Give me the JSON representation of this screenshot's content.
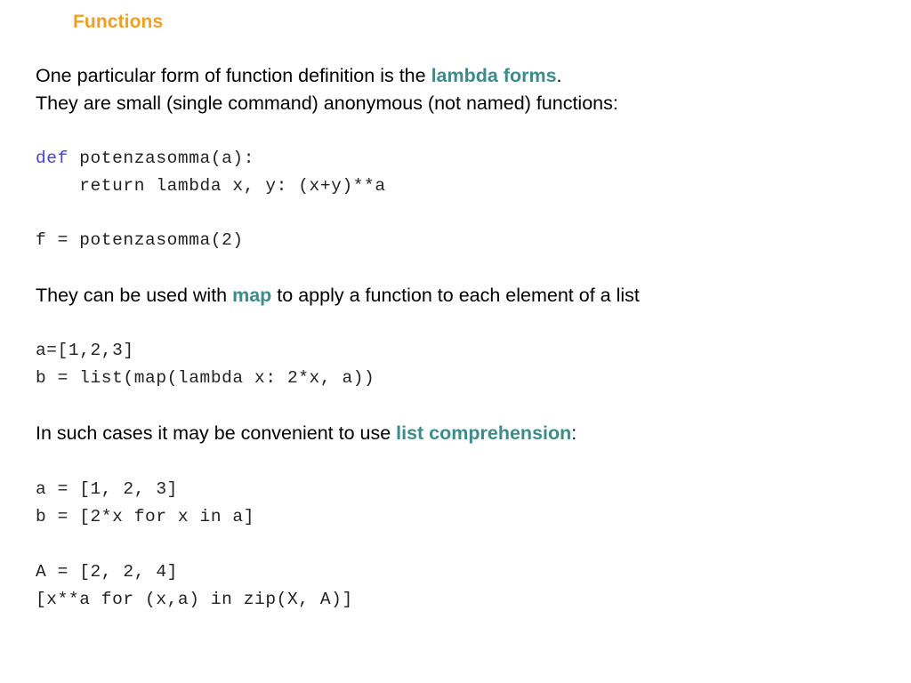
{
  "slide": {
    "title": "Functions",
    "colors": {
      "title": "#f0a01e",
      "keyword_teal": "#3d8b8b",
      "code_keyword_blue": "#4a43cc",
      "body_text": "#000000",
      "code_text": "#222222",
      "background": "#ffffff"
    }
  },
  "intro": {
    "line1_before": "One particular form of function definition is the ",
    "line1_highlight": "lambda forms",
    "line1_after": ".",
    "line2": "They are small (single command) anonymous (not named) functions:"
  },
  "code_block_1": {
    "line1_keyword": "def",
    "line1_rest": " potenzasomma(a):",
    "line2": "    return lambda x, y: (x+y)**a"
  },
  "code_block_2": {
    "line1": "f = potenzasomma(2)"
  },
  "map_para": {
    "before": "They can be used with ",
    "highlight": "map",
    "after": " to apply a function to each element of a list"
  },
  "code_block_3": {
    "line1": "a=[1,2,3]",
    "line2": "b = list(map(lambda x: 2*x, a))"
  },
  "comprehension_para": {
    "before": "In such cases it may be convenient to use ",
    "highlight": "list comprehension",
    "after": ":"
  },
  "code_block_4": {
    "line1": "a = [1, 2, 3]",
    "line2": "b = [2*x for x in a]"
  },
  "code_block_5": {
    "line1": "A = [2, 2, 4]",
    "line2": "[x**a for (x,a) in zip(X, A)]"
  }
}
